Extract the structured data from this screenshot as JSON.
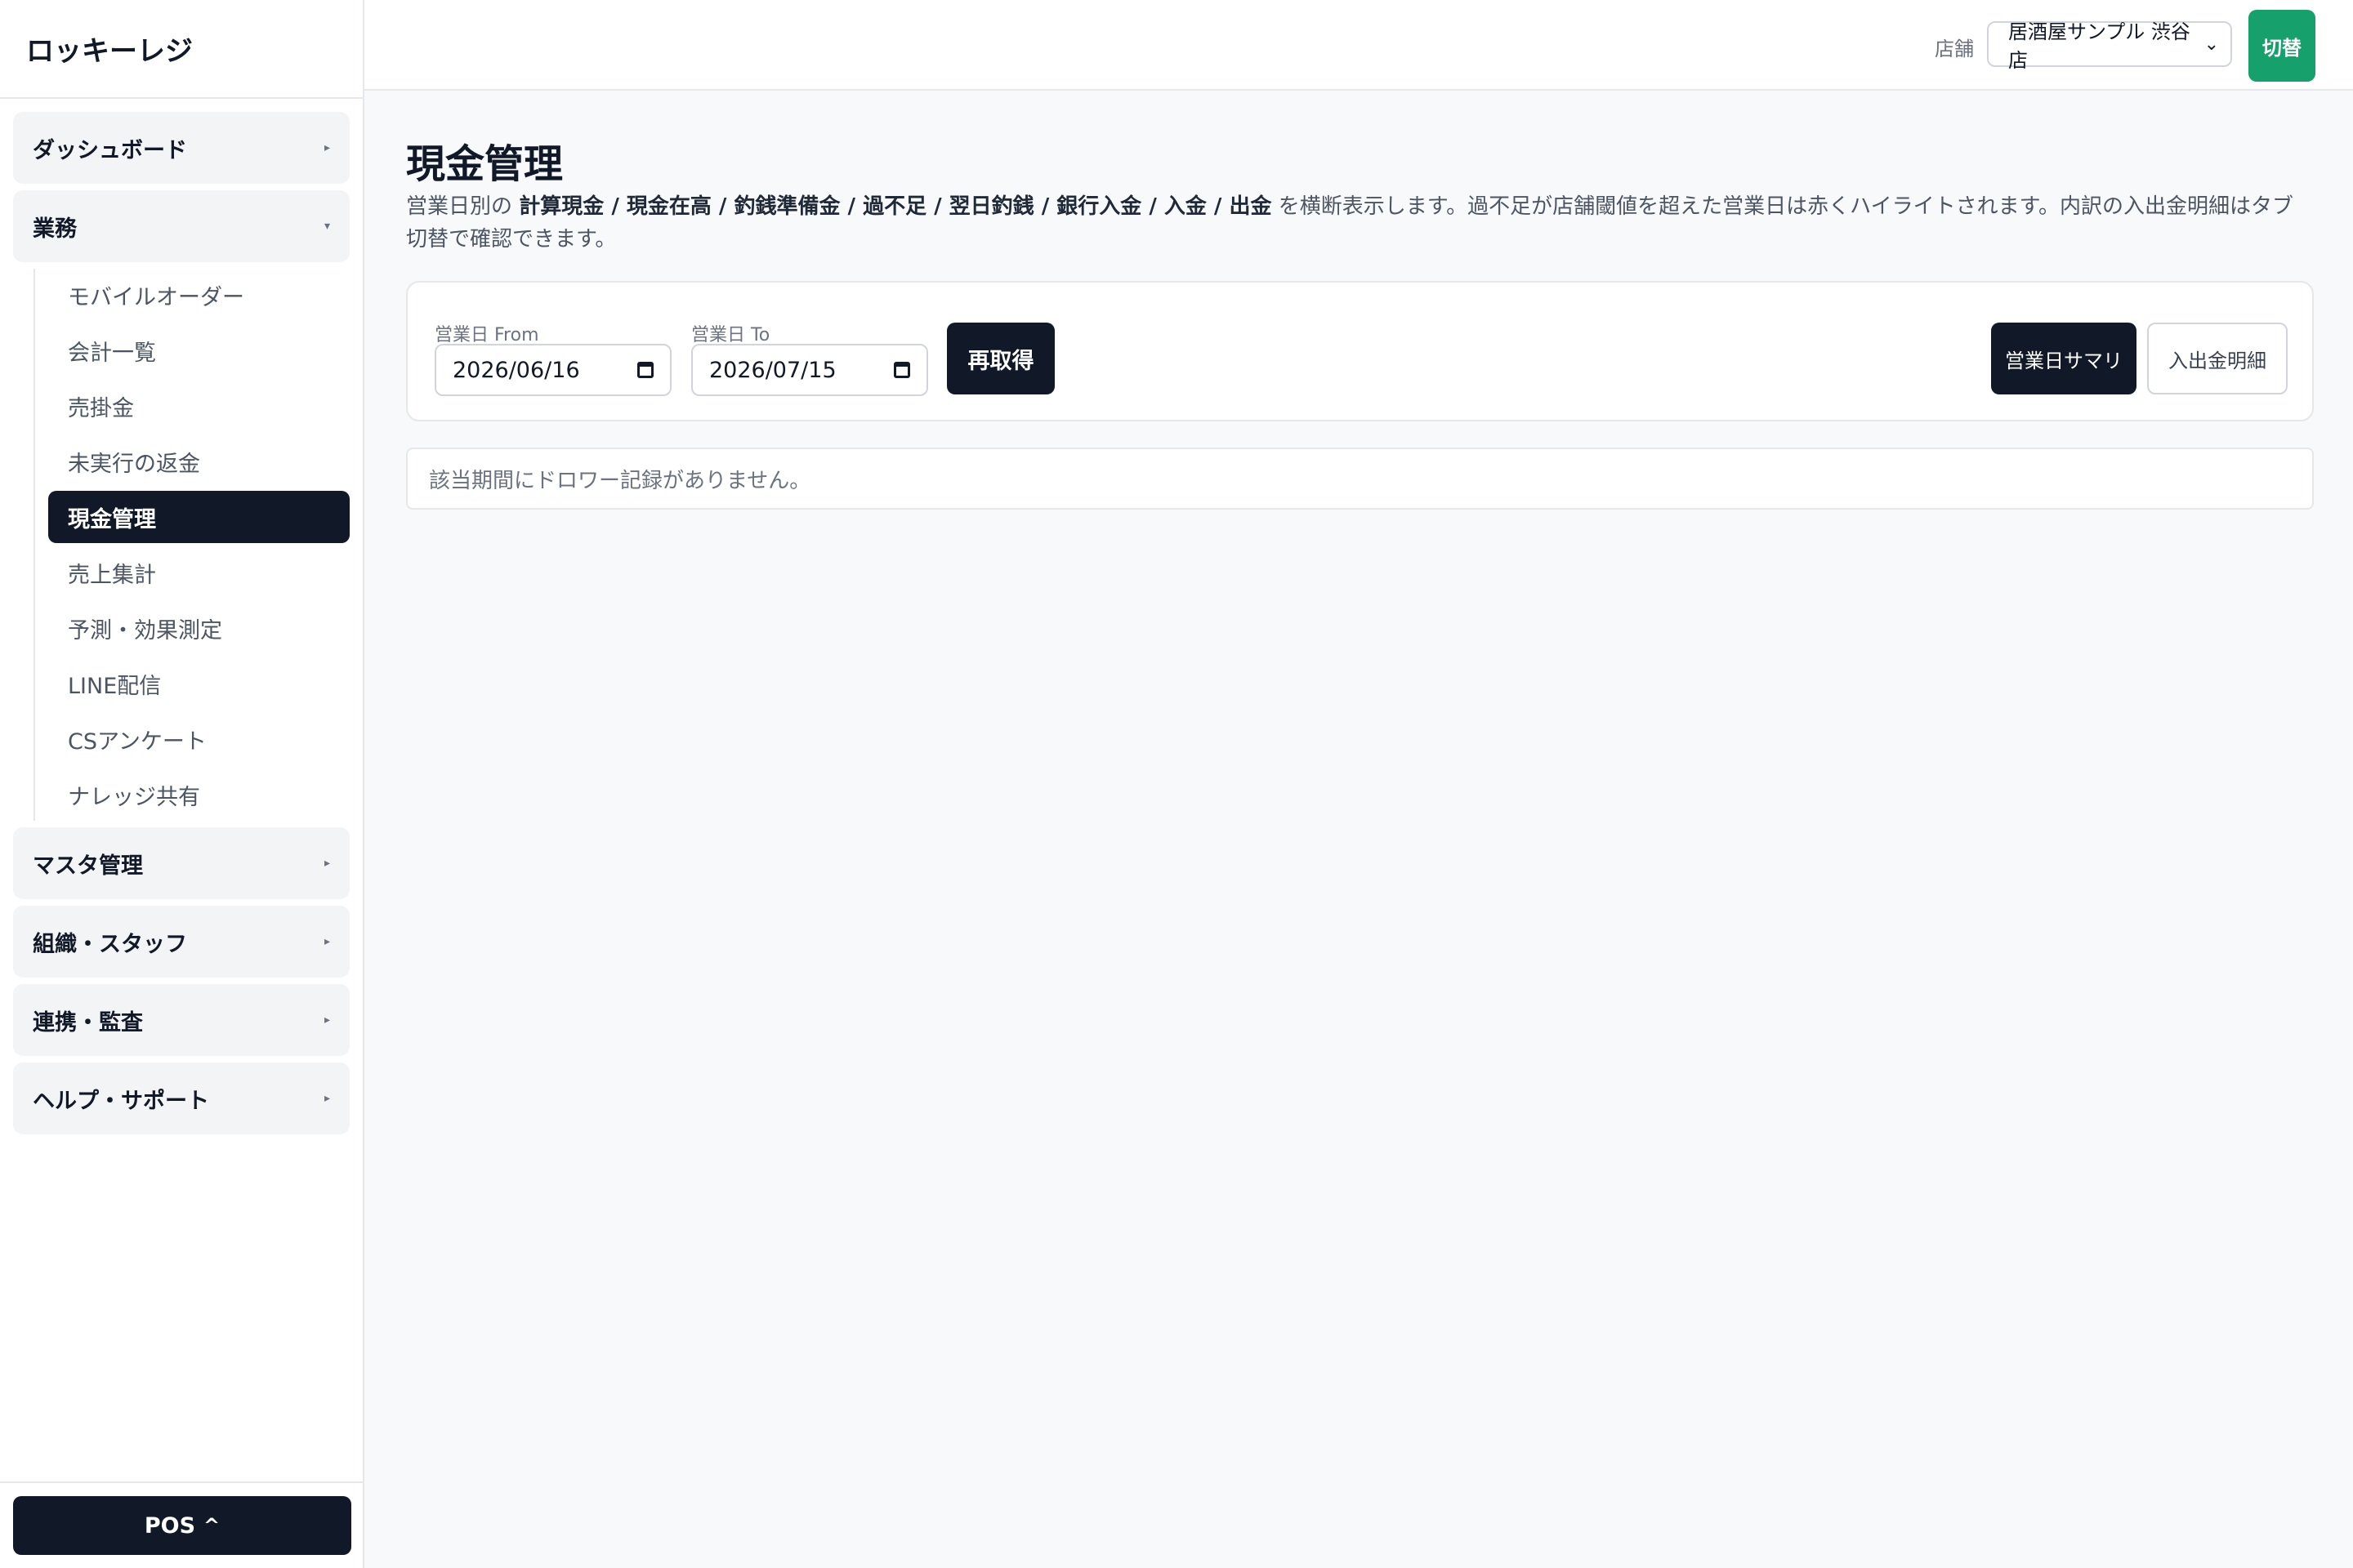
{
  "app": {
    "title": "ロッキーレジ"
  },
  "sidebar": {
    "groups": [
      {
        "label": "ダッシュボード",
        "caret": "▸"
      },
      {
        "label": "業務",
        "caret": "▾"
      },
      {
        "label": "マスタ管理",
        "caret": "▸"
      },
      {
        "label": "組織・スタッフ",
        "caret": "▸"
      },
      {
        "label": "連携・監査",
        "caret": "▸"
      },
      {
        "label": "ヘルプ・サポート",
        "caret": "▸"
      }
    ],
    "business_items": [
      {
        "label": "モバイルオーダー"
      },
      {
        "label": "会計一覧"
      },
      {
        "label": "売掛金"
      },
      {
        "label": "未実行の返金"
      },
      {
        "label": "現金管理",
        "active": true
      },
      {
        "label": "売上集計"
      },
      {
        "label": "予測・効果測定"
      },
      {
        "label": "LINE配信"
      },
      {
        "label": "CSアンケート"
      },
      {
        "label": "ナレッジ共有"
      }
    ],
    "pos_button": {
      "label": "POS",
      "chevron": "^"
    }
  },
  "topbar": {
    "store_label": "店舗",
    "store_selected": "居酒屋サンプル 渋谷店",
    "switch_button": "切替"
  },
  "page": {
    "title": "現金管理",
    "desc_prefix": "営業日別の ",
    "desc_bold": "計算現金 / 現金在高 / 釣銭準備金 / 過不足 / 翌日釣銭 / 銀行入金 / 入金 / 出金",
    "desc_suffix": " を横断表示します。過不足が店舗閾値を超えた営業日は赤くハイライトされます。内訳の入出金明細はタブ切替で確認できます。"
  },
  "filters": {
    "from_label": "営業日 From",
    "from_value": "2026/06/16",
    "to_label": "営業日 To",
    "to_value": "2026/07/15",
    "refetch_button": "再取得"
  },
  "tabs": {
    "summary": "営業日サマリ",
    "details": "入出金明細",
    "active": "summary"
  },
  "empty_message": "該当期間にドロワー記録がありません。",
  "colors": {
    "primary": "#111827",
    "accent_green": "#16a06b",
    "background": "#f8f9fb",
    "border": "#e5e7eb"
  }
}
